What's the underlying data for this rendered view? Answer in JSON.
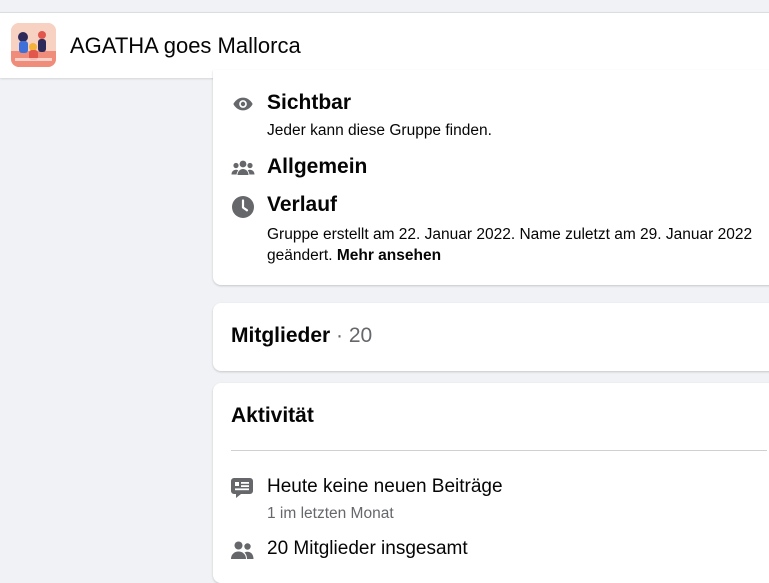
{
  "header": {
    "group_name": "AGATHA goes Mallorca",
    "avatar_icon": "group-cover-illustration"
  },
  "about": {
    "visibility": {
      "icon": "eye-icon",
      "title": "Sichtbar",
      "description": "Jeder kann diese Gruppe finden."
    },
    "general": {
      "icon": "people-icon",
      "title": "Allgemein"
    },
    "history": {
      "icon": "clock-icon",
      "title": "Verlauf",
      "description": "Gruppe erstellt am 22. Januar 2022. Name zuletzt am 29. Januar 2022 geändert.",
      "more_link": "Mehr ansehen"
    }
  },
  "members": {
    "title": "Mitglieder",
    "separator": "·",
    "count": "20"
  },
  "activity": {
    "title": "Aktivität",
    "items": [
      {
        "icon": "chat-icon",
        "text": "Heute keine neuen Beiträge",
        "subtext": "1 im letzten Monat"
      },
      {
        "icon": "people-icon",
        "text": "20 Mitglieder insgesamt"
      }
    ]
  },
  "colors": {
    "background": "#f0f2f5",
    "card": "#ffffff",
    "icon_gray": "#65676b",
    "text_primary": "#050505",
    "text_secondary": "#65676b"
  }
}
